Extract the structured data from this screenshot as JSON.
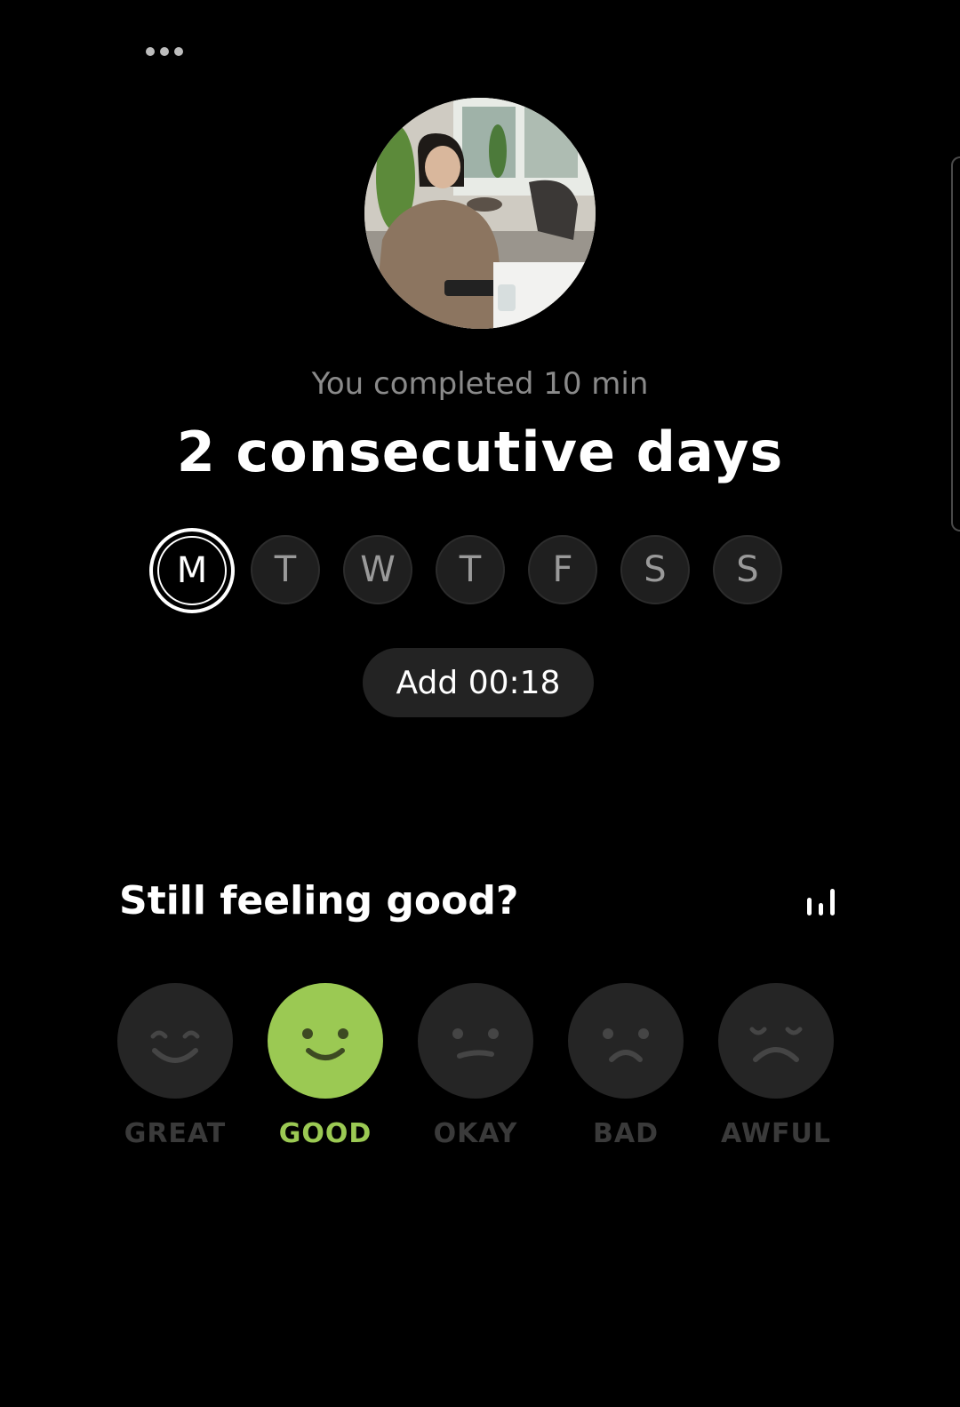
{
  "header": {
    "more_icon": "more-horizontal-icon"
  },
  "summary": {
    "subtitle": "You completed 10 min",
    "headline": "2 consecutive days"
  },
  "week": {
    "days": [
      "M",
      "T",
      "W",
      "T",
      "F",
      "S",
      "S"
    ],
    "active_index": 0
  },
  "add_button": {
    "label": "Add 00:18"
  },
  "mood": {
    "question": "Still feeling good?",
    "stats_icon": "bar-chart-icon",
    "options": [
      {
        "label": "GREAT",
        "icon": "great-face-icon"
      },
      {
        "label": "GOOD",
        "icon": "good-face-icon"
      },
      {
        "label": "OKAY",
        "icon": "okay-face-icon"
      },
      {
        "label": "BAD",
        "icon": "bad-face-icon"
      },
      {
        "label": "AWFUL",
        "icon": "awful-face-icon"
      }
    ],
    "selected": "GOOD"
  },
  "colors": {
    "background": "#000000",
    "accent": "#9bc953",
    "muted_text": "#8a8a8a",
    "chip_background": "#232323"
  }
}
